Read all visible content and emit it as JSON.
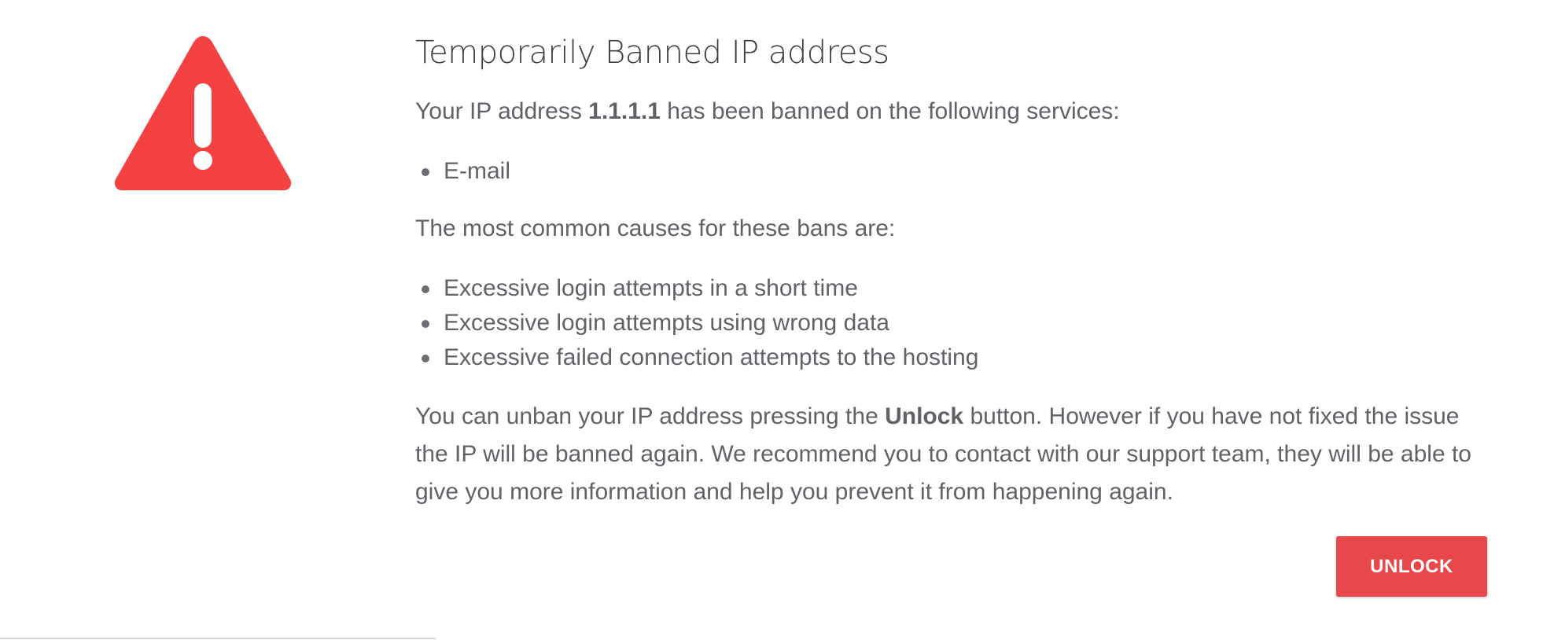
{
  "header": {
    "icon": "warning-icon",
    "title": "Temporarily Banned IP address"
  },
  "intro": {
    "prefix": "Your IP address ",
    "ip": "1.1.1.1",
    "suffix": " has been banned on the following services:"
  },
  "services": [
    "E-mail"
  ],
  "causes": {
    "intro": "The most common causes for these bans are:",
    "items": [
      "Excessive login attempts in a short time",
      "Excessive login attempts using wrong data",
      "Excessive failed connection attempts to the hosting"
    ]
  },
  "explanation": {
    "prefix": "You can unban your IP address pressing the ",
    "button_ref": "Unlock",
    "suffix": " button. However if you have not fixed the issue the IP will be banned again. We recommend you to contact with our support team, they will be able to give you more information and help you prevent it from happening again."
  },
  "actions": {
    "unlock_label": "UNLOCK"
  },
  "colors": {
    "accent": "#e8484a",
    "warning_icon": "#f44242",
    "text": "#5f6368",
    "title": "#3c4043"
  }
}
